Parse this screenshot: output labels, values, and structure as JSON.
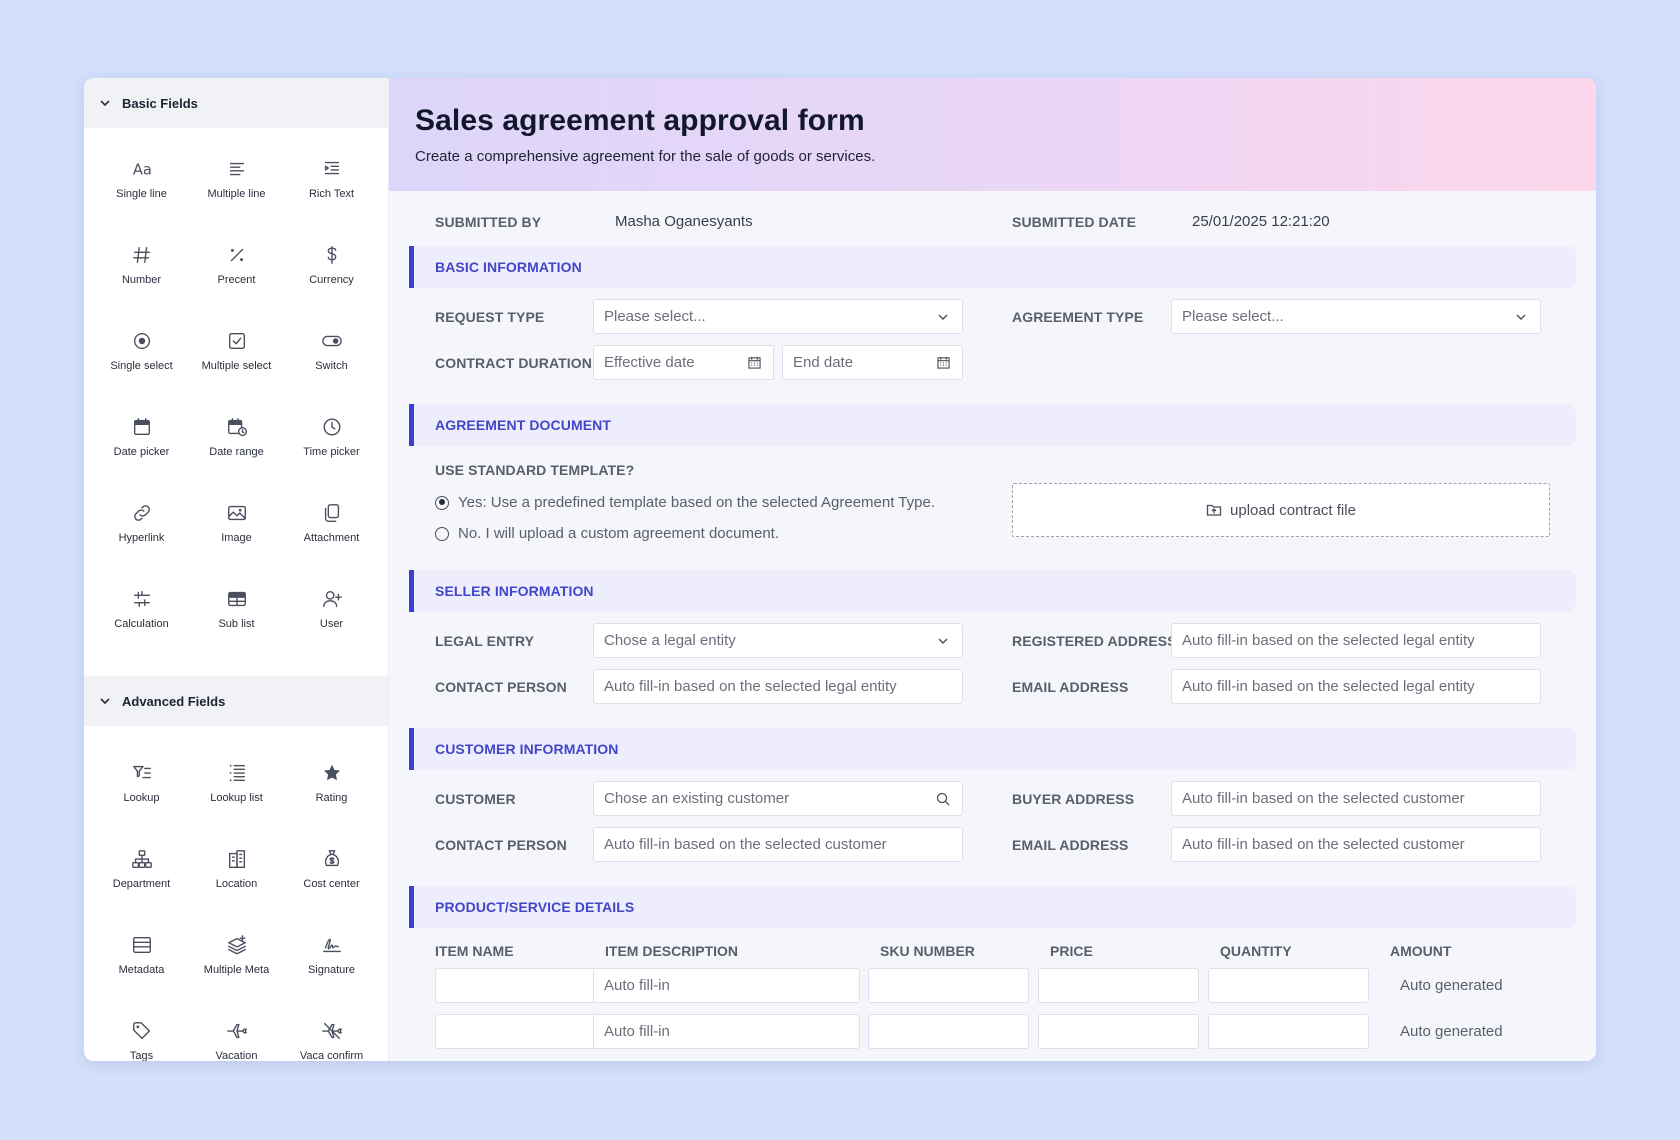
{
  "sidebar": {
    "basic_header": "Basic Fields",
    "basic_items": [
      {
        "label": "Single line",
        "icon": "text-aa-icon"
      },
      {
        "label": "Multiple line",
        "icon": "lines-icon"
      },
      {
        "label": "Rich Text",
        "icon": "rich-text-icon"
      },
      {
        "label": "Number",
        "icon": "hash-icon"
      },
      {
        "label": "Precent",
        "icon": "percent-icon"
      },
      {
        "label": "Currency",
        "icon": "dollar-icon"
      },
      {
        "label": "Single select",
        "icon": "radio-icon"
      },
      {
        "label": "Multiple select",
        "icon": "checkbox-icon"
      },
      {
        "label": "Switch",
        "icon": "toggle-icon"
      },
      {
        "label": "Date picker",
        "icon": "calendar-icon"
      },
      {
        "label": "Date range",
        "icon": "calendar-clock-icon"
      },
      {
        "label": "Time picker",
        "icon": "clock-icon"
      },
      {
        "label": "Hyperlink",
        "icon": "link-icon"
      },
      {
        "label": "Image",
        "icon": "image-icon"
      },
      {
        "label": "Attachment",
        "icon": "attachment-icon"
      },
      {
        "label": "Calculation",
        "icon": "sliders-icon"
      },
      {
        "label": "Sub list",
        "icon": "table-icon"
      },
      {
        "label": "User",
        "icon": "user-plus-icon"
      }
    ],
    "advanced_header": "Advanced Fields",
    "advanced_items": [
      {
        "label": "Lookup",
        "icon": "filter-list-icon"
      },
      {
        "label": "Lookup list",
        "icon": "list-stack-icon"
      },
      {
        "label": "Rating",
        "icon": "star-icon"
      },
      {
        "label": "Department",
        "icon": "org-chart-icon"
      },
      {
        "label": "Location",
        "icon": "building-icon"
      },
      {
        "label": "Cost center",
        "icon": "money-bag-icon"
      },
      {
        "label": "Metadata",
        "icon": "metadata-icon"
      },
      {
        "label": "Multiple Meta",
        "icon": "layers-icon"
      },
      {
        "label": "Signature",
        "icon": "signature-icon"
      },
      {
        "label": "Tags",
        "icon": "tag-icon"
      },
      {
        "label": "Vacation",
        "icon": "plane-icon"
      },
      {
        "label": "Vaca confirm",
        "icon": "plane-off-icon"
      }
    ]
  },
  "header": {
    "title": "Sales agreement approval form",
    "subtitle": "Create a comprehensive agreement for the sale of goods or services."
  },
  "meta": {
    "submitted_by_label": "SUBMITTED BY",
    "submitted_by_value": "Masha Oganesyants",
    "submitted_date_label": "SUBMITTED DATE",
    "submitted_date_value": "25/01/2025 12:21:20"
  },
  "basic": {
    "section": "BASIC INFORMATION",
    "request_type_label": "REQUEST TYPE",
    "request_type_placeholder": "Please select...",
    "agreement_type_label": "AGREEMENT TYPE",
    "agreement_type_placeholder": "Please select...",
    "duration_label": "CONTRACT DURATION",
    "effective_placeholder": "Effective date",
    "end_placeholder": "End date"
  },
  "document": {
    "section": "AGREEMENT DOCUMENT",
    "question": "USE STANDARD TEMPLATE?",
    "option_yes": "Yes: Use a predefined template based on the selected Agreement Type.",
    "option_no": "No. I will upload a custom agreement document.",
    "upload_label": "upload contract file"
  },
  "seller": {
    "section": "SELLER INFORMATION",
    "legal_entity_label": "LEGAL ENTRY",
    "legal_entity_placeholder": "Chose a legal entity",
    "address_label": "REGISTERED ADDRESS",
    "address_placeholder": "Auto fill-in based on the selected legal entity",
    "contact_label": "CONTACT PERSON",
    "contact_placeholder": "Auto fill-in based on the selected legal entity",
    "email_label": "EMAIL ADDRESS",
    "email_placeholder": "Auto fill-in based on the selected legal entity"
  },
  "customer": {
    "section": "CUSTOMER INFORMATION",
    "customer_label": "CUSTOMER",
    "customer_placeholder": "Chose an existing customer",
    "buyer_address_label": "BUYER ADDRESS",
    "buyer_address_placeholder": "Auto fill-in based on the selected customer",
    "contact_label": "CONTACT PERSON",
    "contact_placeholder": "Auto fill-in based on the selected customer",
    "email_label": "EMAIL ADDRESS",
    "email_placeholder": "Auto fill-in based on the selected customer"
  },
  "products": {
    "section": "PRODUCT/SERVICE DETAILS",
    "columns": [
      "ITEM NAME",
      "ITEM DESCRIPTION",
      "SKU NUMBER",
      "PRICE",
      "QUANTITY",
      "AMOUNT"
    ],
    "rows": [
      {
        "description": "Auto fill-in",
        "amount": "Auto generated"
      },
      {
        "description": "Auto fill-in",
        "amount": "Auto generated"
      }
    ]
  }
}
